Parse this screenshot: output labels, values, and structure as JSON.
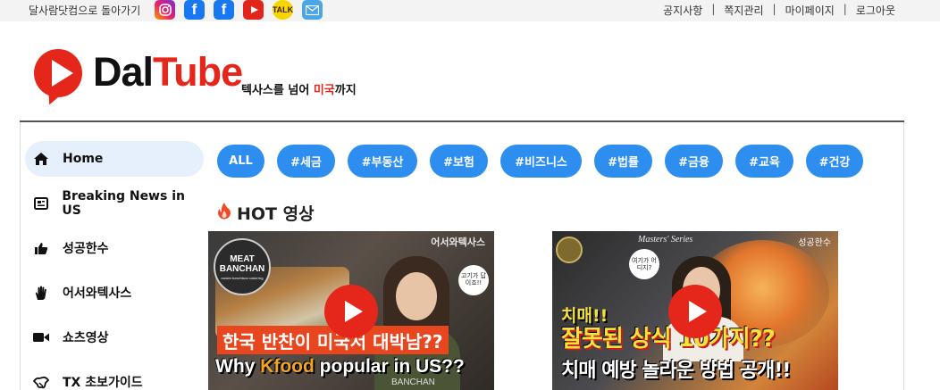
{
  "topbar": {
    "home_link": "달사람닷컴으로 돌아가기",
    "social_icons": [
      "instagram-icon",
      "facebook-icon",
      "facebook-icon",
      "youtube-icon",
      "kakaotalk-icon",
      "email-icon"
    ],
    "menu": [
      "공지사항",
      "쪽지관리",
      "마이페이지",
      "로그아웃"
    ]
  },
  "header": {
    "brand_dal": "Dal",
    "brand_tube": "Tube",
    "tagline_prefix": "텍사스를 넘어 ",
    "tagline_highlight": "미국",
    "tagline_suffix": "까지",
    "colors": {
      "brand_red": "#e5261b",
      "accent_blue": "#2d8ef0"
    }
  },
  "sidebar": {
    "items": [
      {
        "label": "Home",
        "icon": "home-icon",
        "active": true
      },
      {
        "label": "Breaking News in US",
        "icon": "newspaper-icon"
      },
      {
        "label": "성공한수",
        "icon": "thumbs-up-icon"
      },
      {
        "label": "어서와텍사스",
        "icon": "hand-icon"
      },
      {
        "label": "쇼츠영상",
        "icon": "video-camera-icon"
      },
      {
        "label": "TX 초보가이드",
        "icon": "handshake-icon"
      }
    ]
  },
  "categories": [
    "ALL",
    "#세금",
    "#부동산",
    "#보험",
    "#비즈니스",
    "#법률",
    "#금융",
    "#교육",
    "#건강"
  ],
  "hot": {
    "title": "HOT 영상",
    "videos": [
      {
        "logo_line1": "MEAT",
        "logo_line2": "BANCHAN",
        "logo_sub": "meals·lunchbox·catering",
        "channel": "어서와텍사스",
        "bubble": "고기가 답이죠!!",
        "headline": "한국 반찬이 미국서 대박남??",
        "english_prefix": "Why ",
        "english_highlight": "Kfood",
        "english_suffix": " popular in US??",
        "shirt_text": "BANCHAN"
      },
      {
        "series": "Masters' Series",
        "channel": "성공한수",
        "bubble": "여기가 어디지?",
        "line1": "치매!!",
        "line2": "잘못된 상식 10가지??",
        "line3": "치매 예방 놀라운 방법 공개!!"
      }
    ]
  }
}
